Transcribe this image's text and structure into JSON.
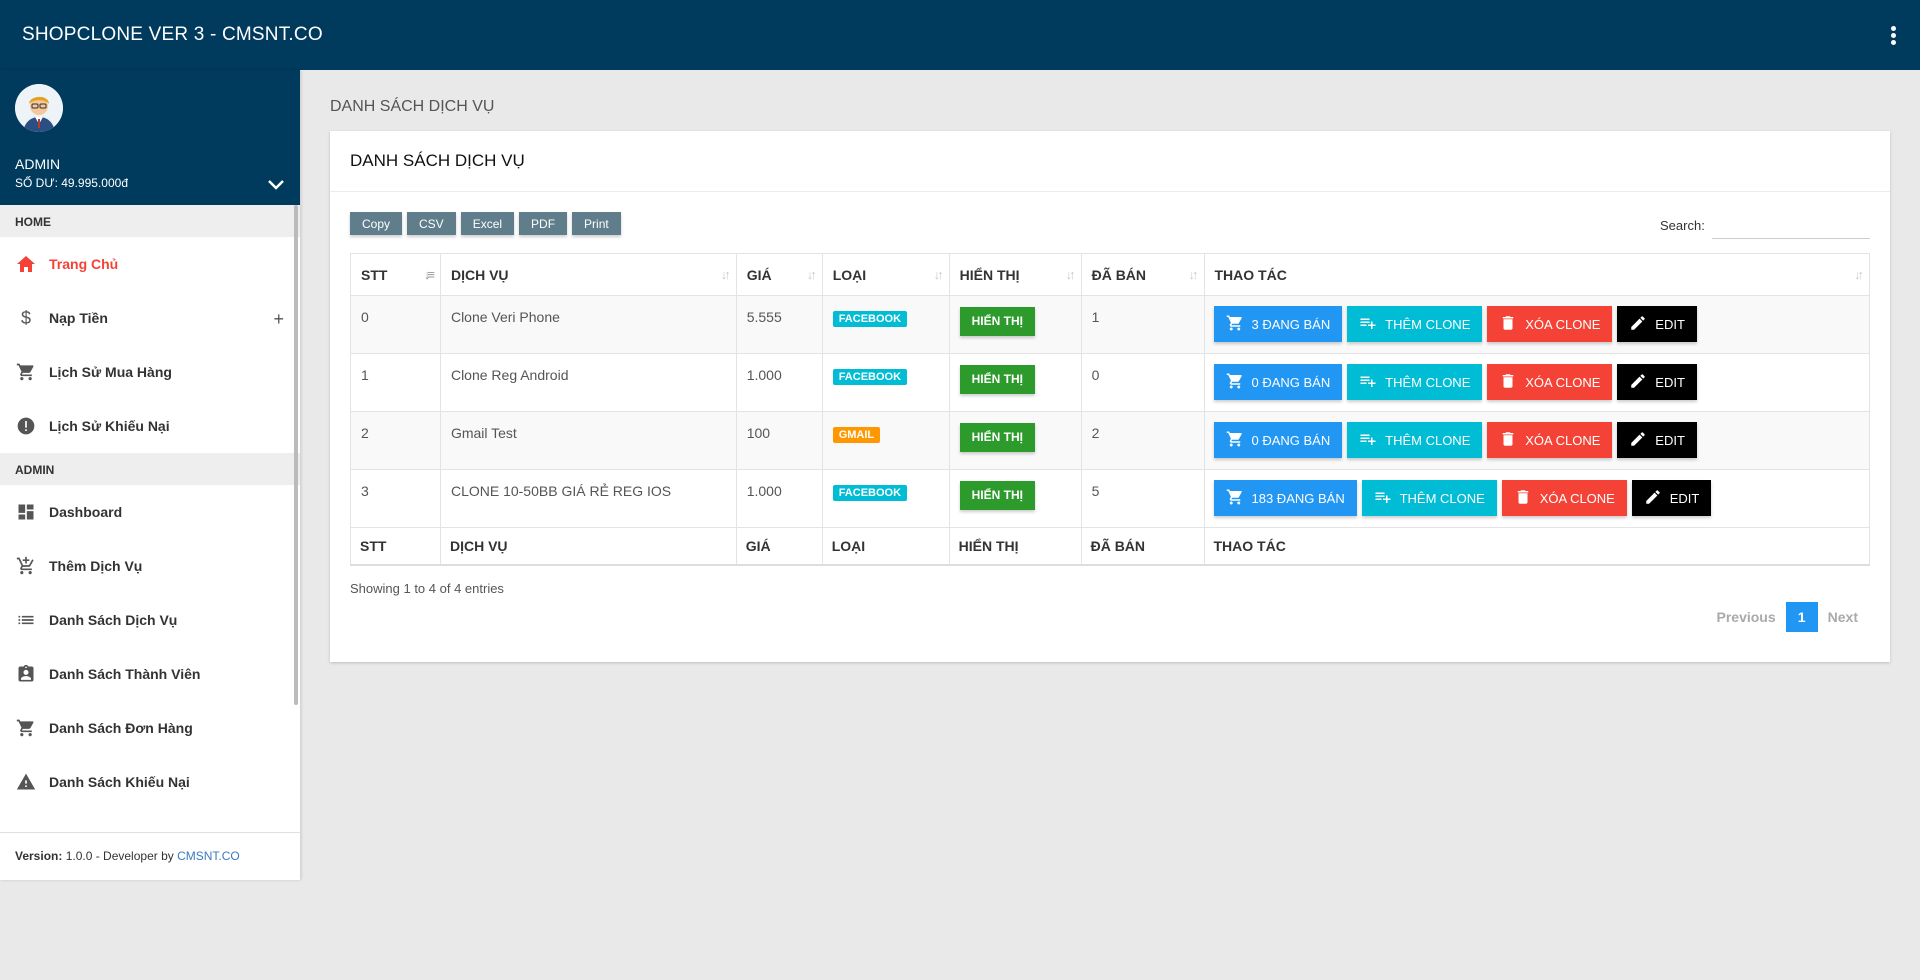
{
  "header": {
    "title": "SHOPCLONE VER 3 - CMSNT.CO"
  },
  "user": {
    "name": "ADMIN",
    "balance": "SỐ DƯ: 49.995.000đ"
  },
  "sidebar": {
    "home_header": "HOME",
    "admin_header": "ADMIN",
    "home_items": [
      {
        "label": "Trang Chủ",
        "icon": "home-icon",
        "active": true
      },
      {
        "label": "Nạp Tiền",
        "icon": "dollar-icon"
      },
      {
        "label": "Lịch Sử Mua Hàng",
        "icon": "cart-icon"
      },
      {
        "label": "Lịch Sử Khiếu Nại",
        "icon": "alert-circle-icon"
      }
    ],
    "admin_items": [
      {
        "label": "Dashboard",
        "icon": "dashboard-icon"
      },
      {
        "label": "Thêm Dịch Vụ",
        "icon": "cart-plus-icon"
      },
      {
        "label": "Danh Sách Dịch Vụ",
        "icon": "list-icon"
      },
      {
        "label": "Danh Sách Thành Viên",
        "icon": "contact-card-icon"
      },
      {
        "label": "Danh Sách Đơn Hàng",
        "icon": "cart-icon"
      },
      {
        "label": "Danh Sách Khiếu Nại",
        "icon": "warning-icon"
      }
    ],
    "expand_symbol": "+",
    "footer": {
      "version_label": "Version:",
      "version_text": " 1.0.0 - Developer by ",
      "developer": "CMSNT.CO"
    }
  },
  "page": {
    "heading": "DANH SÁCH DỊCH VỤ",
    "card_title": "DANH SÁCH DỊCH VỤ",
    "export_buttons": [
      "Copy",
      "CSV",
      "Excel",
      "PDF",
      "Print"
    ],
    "search_label": "Search:",
    "search_value": ""
  },
  "table": {
    "columns": [
      "STT",
      "DỊCH VỤ",
      "GIÁ",
      "LOẠI",
      "HIỂN THỊ",
      "ĐÃ BÁN",
      "THAO TÁC"
    ],
    "rows": [
      {
        "stt": "0",
        "service": "Clone Veri Phone",
        "price": "5.555",
        "type": "FACEBOOK",
        "display": "HIỂN THỊ",
        "sold": "1",
        "selling": "3 ĐANG BÁN"
      },
      {
        "stt": "1",
        "service": "Clone Reg Android",
        "price": "1.000",
        "type": "FACEBOOK",
        "display": "HIỂN THỊ",
        "sold": "0",
        "selling": "0 ĐANG BÁN"
      },
      {
        "stt": "2",
        "service": "Gmail Test",
        "price": "100",
        "type": "GMAIL",
        "display": "HIỂN THỊ",
        "sold": "2",
        "selling": "0 ĐANG BÁN"
      },
      {
        "stt": "3",
        "service": "CLONE 10-50BB GIÁ RẺ REG IOS",
        "price": "1.000",
        "type": "FACEBOOK",
        "display": "HIỂN THỊ",
        "sold": "5",
        "selling": "183 ĐANG BÁN"
      }
    ],
    "action_labels": {
      "add": "THÊM CLONE",
      "delete": "XÓA CLONE",
      "edit": "EDIT"
    },
    "badge_colors": {
      "FACEBOOK": "#00bcd4",
      "GMAIL": "#ff9800"
    }
  },
  "pagination": {
    "info": "Showing 1 to 4 of 4 entries",
    "previous": "Previous",
    "current": "1",
    "next": "Next"
  }
}
